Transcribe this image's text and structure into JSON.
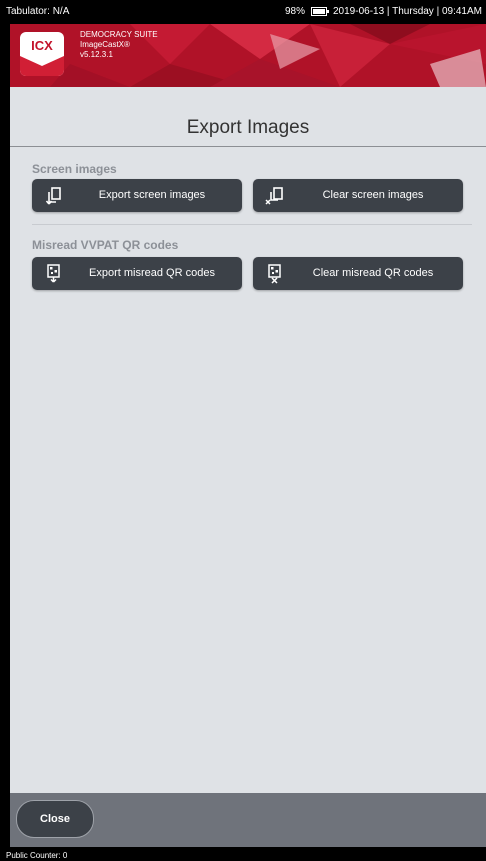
{
  "status_bar": {
    "tabulator": "Tabulator: N/A",
    "battery": "98%",
    "battery_level": 0.98,
    "datetime": "2019-06-13 | Thursday | 09:41AM"
  },
  "brand": {
    "logo_text": "ICX",
    "suite": "DEMOCRACY SUITE",
    "product": "ImageCastX®",
    "version": "v5.12.3.1",
    "color": "#b01228"
  },
  "page": {
    "title": "Export Images"
  },
  "sections": {
    "screen": {
      "label": "Screen images",
      "export_label": "Export screen images",
      "clear_label": "Clear screen images"
    },
    "qr": {
      "label": "Misread VVPAT QR codes",
      "export_label": "Export misread QR codes",
      "clear_label": "Clear misread QR codes"
    }
  },
  "icons": {
    "export_screen": "export-screen-images-icon",
    "clear_screen": "clear-screen-images-icon",
    "export_qr": "export-qr-codes-icon",
    "clear_qr": "clear-qr-codes-icon"
  },
  "footer": {
    "close_label": "Close"
  },
  "bottom_bar": {
    "public_counter": "Public Counter: 0"
  }
}
